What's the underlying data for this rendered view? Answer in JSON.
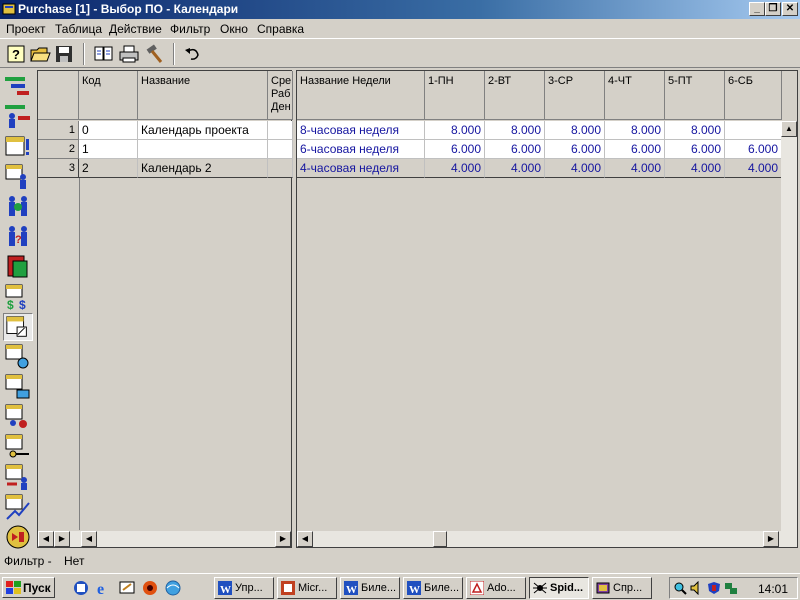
{
  "window": {
    "title": "Purchase [1] - Выбор ПО - Календари",
    "minimize": "_",
    "restore": "❐",
    "close": "✕"
  },
  "menu": [
    "Проект",
    "Таблица",
    "Действие",
    "Фильтр",
    "Окно",
    "Справка"
  ],
  "toolbar": [
    "help-icon",
    "open-folder-icon",
    "save-icon",
    "book-icon",
    "print-icon",
    "hammer-icon",
    "undo-icon"
  ],
  "left_grid": {
    "headers": {
      "code": "Код",
      "name": "Название",
      "avg": "Сре Раб Ден"
    },
    "rows": [
      {
        "num": "1",
        "code": "0",
        "name": "Календарь проекта"
      },
      {
        "num": "2",
        "code": "1",
        "name": ""
      },
      {
        "num": "3",
        "code": "2",
        "name": "Календарь 2"
      }
    ]
  },
  "right_grid": {
    "headers": [
      "Название Недели",
      "1-ПН",
      "2-ВТ",
      "3-СР",
      "4-ЧТ",
      "5-ПТ",
      "6-СБ"
    ],
    "rows": [
      {
        "week": "8-часовая неделя",
        "values": [
          "8.000",
          "8.000",
          "8.000",
          "8.000",
          "8.000",
          ""
        ]
      },
      {
        "week": "6-часовая неделя",
        "values": [
          "6.000",
          "6.000",
          "6.000",
          "6.000",
          "6.000",
          "6.000"
        ]
      },
      {
        "week": "4-часовая неделя",
        "values": [
          "4.000",
          "4.000",
          "4.000",
          "4.000",
          "4.000",
          "4.000"
        ]
      }
    ]
  },
  "status": {
    "label": "Фильтр -",
    "value": "Нет"
  },
  "taskbar": {
    "start": "Пуск",
    "tasks": [
      "Упр...",
      "Micr...",
      "Биле...",
      "Биле...",
      "Ado...",
      "Spid...",
      "Спр..."
    ],
    "clock": "14:01"
  },
  "colors": {
    "title_start": "#0a246a",
    "week_text": "#1515a0"
  }
}
